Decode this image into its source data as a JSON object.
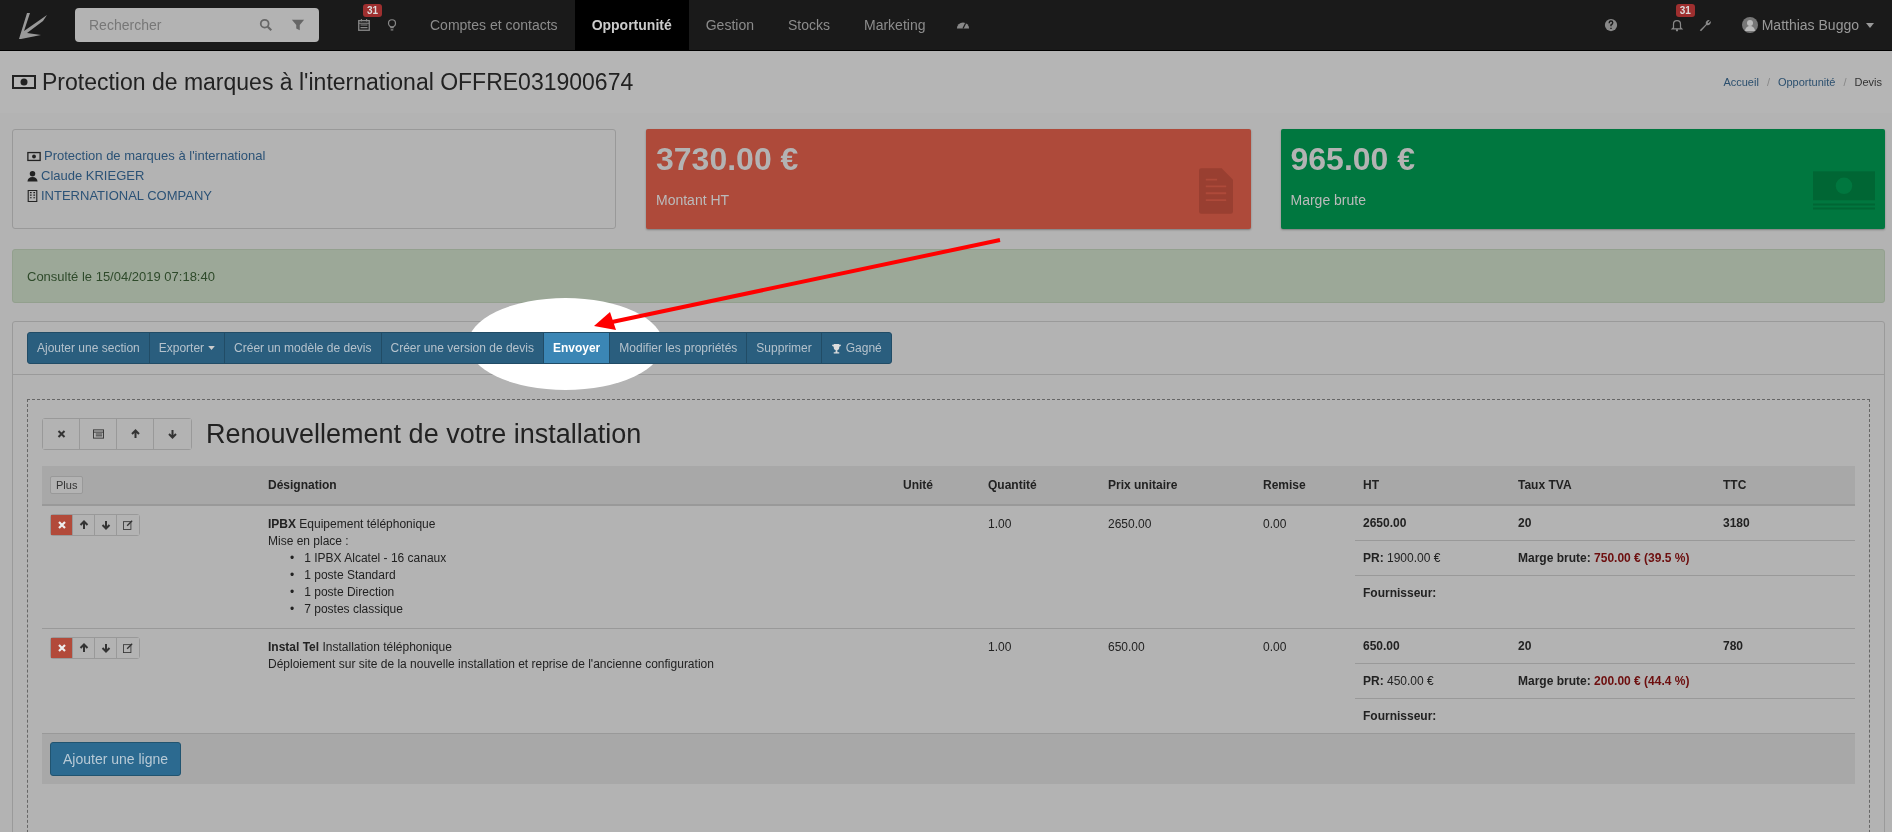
{
  "navbar": {
    "search": {
      "placeholder": "Rechercher"
    },
    "calendar_badge": "31",
    "menu": [
      {
        "label": "Comptes et contacts",
        "selected": false
      },
      {
        "label": "Opportunité",
        "selected": true
      },
      {
        "label": "Gestion",
        "selected": false
      },
      {
        "label": "Stocks",
        "selected": false
      },
      {
        "label": "Marketing",
        "selected": false
      }
    ],
    "notification_badge": "31",
    "user": "Matthias Buggo"
  },
  "page_title": "Protection de marques à l'international OFFRE031900674",
  "breadcrumbs": {
    "separator": "/",
    "items": [
      {
        "label": "Accueil",
        "current": false
      },
      {
        "label": "Opportunité",
        "current": false
      },
      {
        "label": "Devis",
        "current": true
      }
    ]
  },
  "info_links": [
    {
      "kind": "offer",
      "label": "Protection de marques à l'international"
    },
    {
      "kind": "person",
      "label": "Claude KRIEGER"
    },
    {
      "kind": "company",
      "label": "INTERNATIONAL COMPANY"
    }
  ],
  "stats": [
    {
      "kind": "amount",
      "value": "3730.00 €",
      "label": "Montant HT"
    },
    {
      "kind": "margin",
      "value": "965.00 €",
      "label": "Marge brute"
    }
  ],
  "alert": "Consulté le 15/04/2019 07:18:40",
  "toolbar": [
    {
      "kind": "plain",
      "label": "Ajouter une section",
      "highlighted": false
    },
    {
      "kind": "dropdown",
      "label": "Exporter",
      "highlighted": false
    },
    {
      "kind": "plain",
      "label": "Créer un modèle de devis",
      "highlighted": false
    },
    {
      "kind": "plain",
      "label": "Créer une version de devis",
      "highlighted": false
    },
    {
      "kind": "plain",
      "label": "Envoyer",
      "highlighted": true
    },
    {
      "kind": "plain",
      "label": "Modifier les propriétés",
      "highlighted": false
    },
    {
      "kind": "plain",
      "label": "Supprimer",
      "highlighted": false
    },
    {
      "kind": "trophy",
      "label": "Gagné",
      "highlighted": false
    }
  ],
  "section": {
    "title": "Renouvellement de votre installation",
    "plus_button": "Plus",
    "columns": [
      "Désignation",
      "Unité",
      "Quantité",
      "Prix unitaire",
      "Remise",
      "HT",
      "Taux TVA",
      "TTC"
    ],
    "rows": [
      {
        "designation": "**IPBX** Equipement téléphonique",
        "description": "Mise en place :",
        "bullet_mark": "•",
        "bullets": [
          "1 IPBX Alcatel - 16 canaux",
          "1 poste Standard",
          "1 poste Direction",
          "7 postes classique"
        ],
        "quantite": "1.00",
        "prix": "2650.00",
        "remise": "0.00",
        "ht": "2650.00",
        "tva": "20",
        "ttc": "3180",
        "pr": "**PR:** 1900.00 €",
        "marge_label": "Marge brute:",
        "marge_value": "750.00 € (39.5 %)",
        "fournisseur": "Fournisseur:"
      },
      {
        "designation": "**Instal Tel** Installation téléphonique",
        "description": "Déploiement sur site de la nouvelle installation et reprise de l'ancienne configuration",
        "quantite": "1.00",
        "prix": "650.00",
        "remise": "0.00",
        "ht": "650.00",
        "tva": "20",
        "ttc": "780",
        "pr": "**PR:** 450.00 €",
        "marge_label": "Marge brute:",
        "marge_value": "200.00 € (44.4 %)",
        "fournisseur": "Fournisseur:"
      }
    ],
    "add_line": "Ajouter une ligne"
  }
}
